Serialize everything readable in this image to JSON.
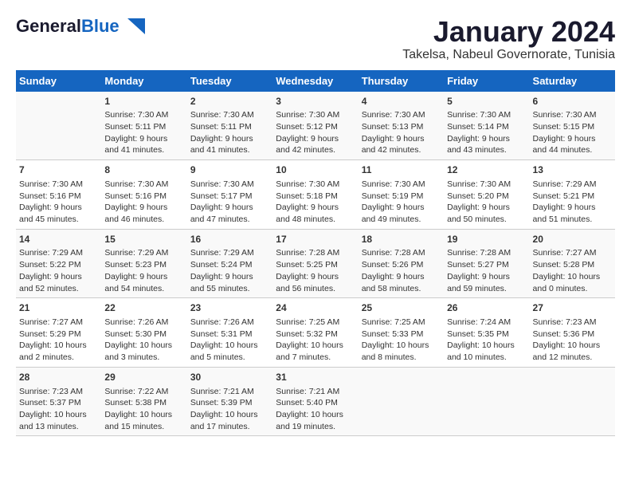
{
  "header": {
    "logo_general": "General",
    "logo_blue": "Blue",
    "title": "January 2024",
    "subtitle": "Takelsa, Nabeul Governorate, Tunisia"
  },
  "calendar": {
    "days_of_week": [
      "Sunday",
      "Monday",
      "Tuesday",
      "Wednesday",
      "Thursday",
      "Friday",
      "Saturday"
    ],
    "weeks": [
      [
        {
          "day": "",
          "content": ""
        },
        {
          "day": "1",
          "content": "Sunrise: 7:30 AM\nSunset: 5:11 PM\nDaylight: 9 hours\nand 41 minutes."
        },
        {
          "day": "2",
          "content": "Sunrise: 7:30 AM\nSunset: 5:11 PM\nDaylight: 9 hours\nand 41 minutes."
        },
        {
          "day": "3",
          "content": "Sunrise: 7:30 AM\nSunset: 5:12 PM\nDaylight: 9 hours\nand 42 minutes."
        },
        {
          "day": "4",
          "content": "Sunrise: 7:30 AM\nSunset: 5:13 PM\nDaylight: 9 hours\nand 42 minutes."
        },
        {
          "day": "5",
          "content": "Sunrise: 7:30 AM\nSunset: 5:14 PM\nDaylight: 9 hours\nand 43 minutes."
        },
        {
          "day": "6",
          "content": "Sunrise: 7:30 AM\nSunset: 5:15 PM\nDaylight: 9 hours\nand 44 minutes."
        }
      ],
      [
        {
          "day": "7",
          "content": "Sunrise: 7:30 AM\nSunset: 5:16 PM\nDaylight: 9 hours\nand 45 minutes."
        },
        {
          "day": "8",
          "content": "Sunrise: 7:30 AM\nSunset: 5:16 PM\nDaylight: 9 hours\nand 46 minutes."
        },
        {
          "day": "9",
          "content": "Sunrise: 7:30 AM\nSunset: 5:17 PM\nDaylight: 9 hours\nand 47 minutes."
        },
        {
          "day": "10",
          "content": "Sunrise: 7:30 AM\nSunset: 5:18 PM\nDaylight: 9 hours\nand 48 minutes."
        },
        {
          "day": "11",
          "content": "Sunrise: 7:30 AM\nSunset: 5:19 PM\nDaylight: 9 hours\nand 49 minutes."
        },
        {
          "day": "12",
          "content": "Sunrise: 7:30 AM\nSunset: 5:20 PM\nDaylight: 9 hours\nand 50 minutes."
        },
        {
          "day": "13",
          "content": "Sunrise: 7:29 AM\nSunset: 5:21 PM\nDaylight: 9 hours\nand 51 minutes."
        }
      ],
      [
        {
          "day": "14",
          "content": "Sunrise: 7:29 AM\nSunset: 5:22 PM\nDaylight: 9 hours\nand 52 minutes."
        },
        {
          "day": "15",
          "content": "Sunrise: 7:29 AM\nSunset: 5:23 PM\nDaylight: 9 hours\nand 54 minutes."
        },
        {
          "day": "16",
          "content": "Sunrise: 7:29 AM\nSunset: 5:24 PM\nDaylight: 9 hours\nand 55 minutes."
        },
        {
          "day": "17",
          "content": "Sunrise: 7:28 AM\nSunset: 5:25 PM\nDaylight: 9 hours\nand 56 minutes."
        },
        {
          "day": "18",
          "content": "Sunrise: 7:28 AM\nSunset: 5:26 PM\nDaylight: 9 hours\nand 58 minutes."
        },
        {
          "day": "19",
          "content": "Sunrise: 7:28 AM\nSunset: 5:27 PM\nDaylight: 9 hours\nand 59 minutes."
        },
        {
          "day": "20",
          "content": "Sunrise: 7:27 AM\nSunset: 5:28 PM\nDaylight: 10 hours\nand 0 minutes."
        }
      ],
      [
        {
          "day": "21",
          "content": "Sunrise: 7:27 AM\nSunset: 5:29 PM\nDaylight: 10 hours\nand 2 minutes."
        },
        {
          "day": "22",
          "content": "Sunrise: 7:26 AM\nSunset: 5:30 PM\nDaylight: 10 hours\nand 3 minutes."
        },
        {
          "day": "23",
          "content": "Sunrise: 7:26 AM\nSunset: 5:31 PM\nDaylight: 10 hours\nand 5 minutes."
        },
        {
          "day": "24",
          "content": "Sunrise: 7:25 AM\nSunset: 5:32 PM\nDaylight: 10 hours\nand 7 minutes."
        },
        {
          "day": "25",
          "content": "Sunrise: 7:25 AM\nSunset: 5:33 PM\nDaylight: 10 hours\nand 8 minutes."
        },
        {
          "day": "26",
          "content": "Sunrise: 7:24 AM\nSunset: 5:35 PM\nDaylight: 10 hours\nand 10 minutes."
        },
        {
          "day": "27",
          "content": "Sunrise: 7:23 AM\nSunset: 5:36 PM\nDaylight: 10 hours\nand 12 minutes."
        }
      ],
      [
        {
          "day": "28",
          "content": "Sunrise: 7:23 AM\nSunset: 5:37 PM\nDaylight: 10 hours\nand 13 minutes."
        },
        {
          "day": "29",
          "content": "Sunrise: 7:22 AM\nSunset: 5:38 PM\nDaylight: 10 hours\nand 15 minutes."
        },
        {
          "day": "30",
          "content": "Sunrise: 7:21 AM\nSunset: 5:39 PM\nDaylight: 10 hours\nand 17 minutes."
        },
        {
          "day": "31",
          "content": "Sunrise: 7:21 AM\nSunset: 5:40 PM\nDaylight: 10 hours\nand 19 minutes."
        },
        {
          "day": "",
          "content": ""
        },
        {
          "day": "",
          "content": ""
        },
        {
          "day": "",
          "content": ""
        }
      ]
    ]
  }
}
